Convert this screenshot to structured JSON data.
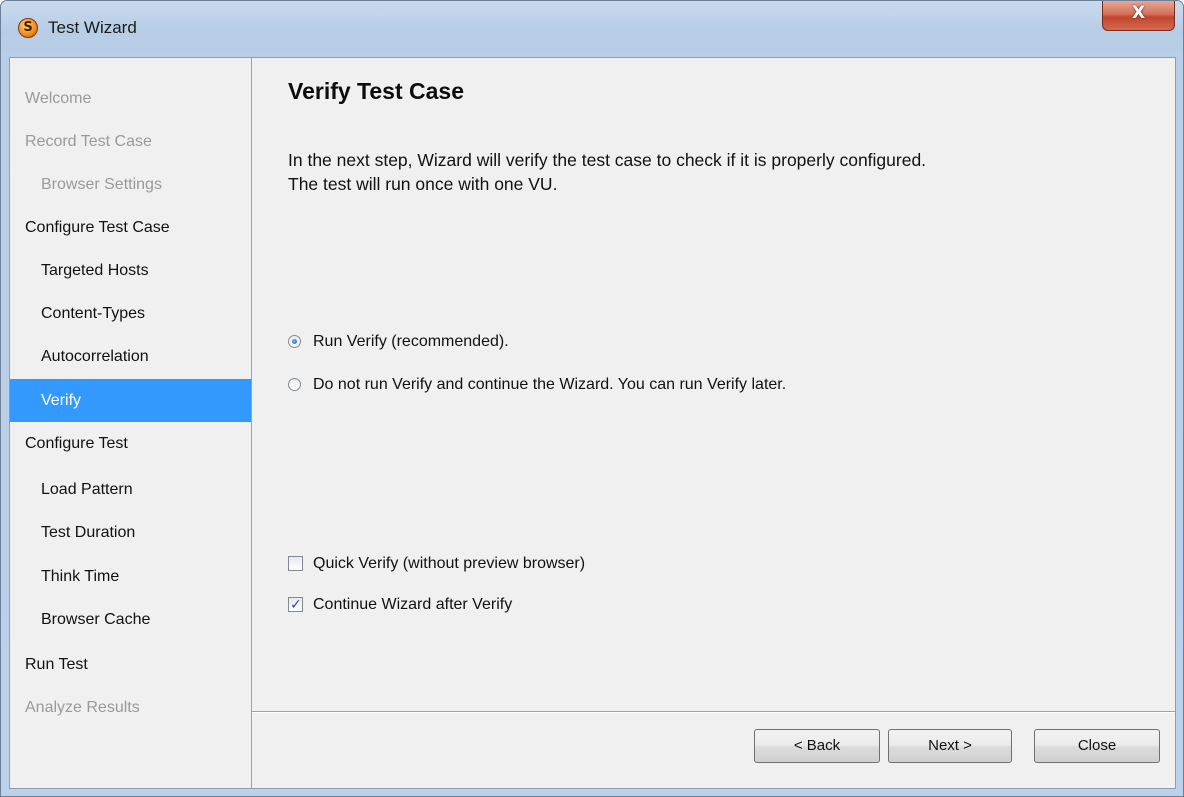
{
  "window": {
    "title": "Test Wizard",
    "app_icon_glyph": "S",
    "close_glyph": "X"
  },
  "sidebar": {
    "items": [
      {
        "label": "Welcome",
        "level": 0,
        "state": "disabled"
      },
      {
        "label": "Record Test Case",
        "level": 0,
        "state": "disabled"
      },
      {
        "label": "Browser Settings",
        "level": 1,
        "state": "disabled"
      },
      {
        "label": "Configure Test Case",
        "level": 0,
        "state": "normal"
      },
      {
        "label": "Targeted Hosts",
        "level": 1,
        "state": "normal"
      },
      {
        "label": "Content-Types",
        "level": 1,
        "state": "normal"
      },
      {
        "label": "Autocorrelation",
        "level": 1,
        "state": "normal"
      },
      {
        "label": "Verify",
        "level": 1,
        "state": "selected"
      },
      {
        "label": "Configure Test",
        "level": 0,
        "state": "normal"
      },
      {
        "label": "Load Pattern",
        "level": 1,
        "state": "normal"
      },
      {
        "label": "Test Duration",
        "level": 1,
        "state": "normal"
      },
      {
        "label": "Think Time",
        "level": 1,
        "state": "normal"
      },
      {
        "label": "Browser Cache",
        "level": 1,
        "state": "normal"
      },
      {
        "label": "Run Test",
        "level": 0,
        "state": "normal"
      },
      {
        "label": "Analyze Results",
        "level": 0,
        "state": "disabled"
      }
    ]
  },
  "main": {
    "title": "Verify Test Case",
    "description_line1": "In the next step, Wizard will verify the test case to check if it is properly configured.",
    "description_line2": "The test will run once with one VU.",
    "radio_options": [
      {
        "label": "Run Verify (recommended).",
        "checked": true
      },
      {
        "label": "Do not run Verify and continue the Wizard. You can run Verify later.",
        "checked": false
      }
    ],
    "checkboxes": [
      {
        "label": "Quick Verify (without preview browser)",
        "checked": false
      },
      {
        "label": "Continue Wizard after Verify",
        "checked": true
      }
    ]
  },
  "buttons": {
    "back": "< Back",
    "next": "Next >",
    "close": "Close"
  },
  "colors": {
    "selection": "#3399ff",
    "disabled_text": "#9a9a9a",
    "panel_bg": "#f0f0f0",
    "titlebar": "#b9cfe8",
    "close_button": "#c2452e"
  }
}
